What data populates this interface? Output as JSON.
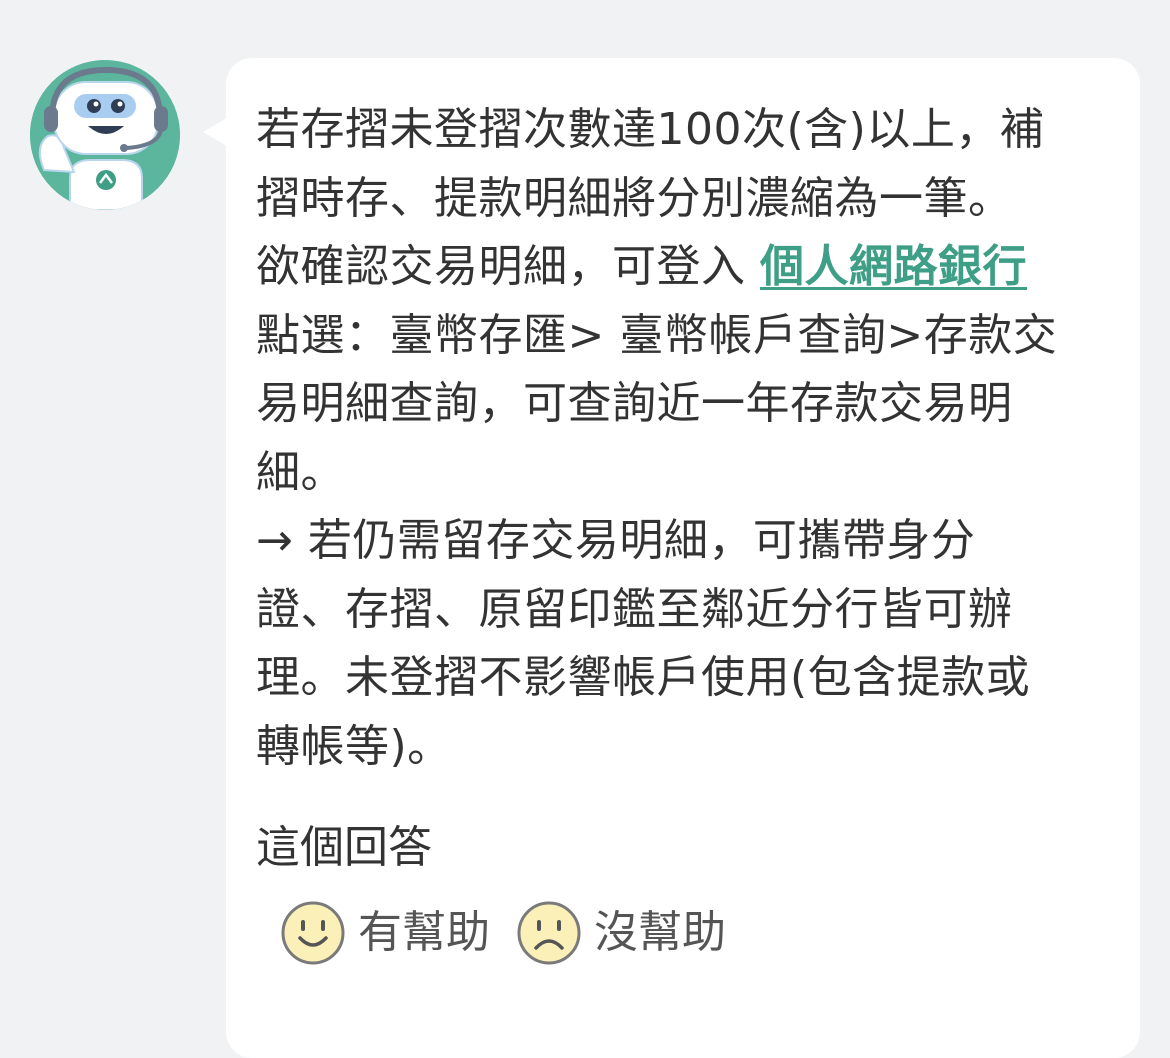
{
  "avatar": {
    "icon": "robot-assistant-icon",
    "bg_color": "#5bb69d"
  },
  "message": {
    "lines": [
      "若存摺未登摺次數達100次(含)以上，補",
      "摺時存、提款明細將分別濃縮為一筆。"
    ],
    "line3_prefix": "欲確認交易明細，可登入 ",
    "link_text": "個人網路銀行",
    "lines_after": [
      "點選：臺幣存匯> 臺幣帳戶查詢>存款交",
      "易明細查詢，可查詢近一年存款交易明",
      "細。",
      "→ 若仍需留存交易明細，可攜帶身分",
      "證、存摺、原留印鑑至鄰近分行皆可辦",
      "理。未登摺不影響帳戶使用(包含提款或",
      "轉帳等)。"
    ],
    "link_color": "#3e9e86"
  },
  "feedback": {
    "title": "這個回答",
    "helpful_label": "有幫助",
    "helpful_icon": "smile-face-icon",
    "not_helpful_label": "沒幫助",
    "not_helpful_icon": "frown-face-icon"
  }
}
